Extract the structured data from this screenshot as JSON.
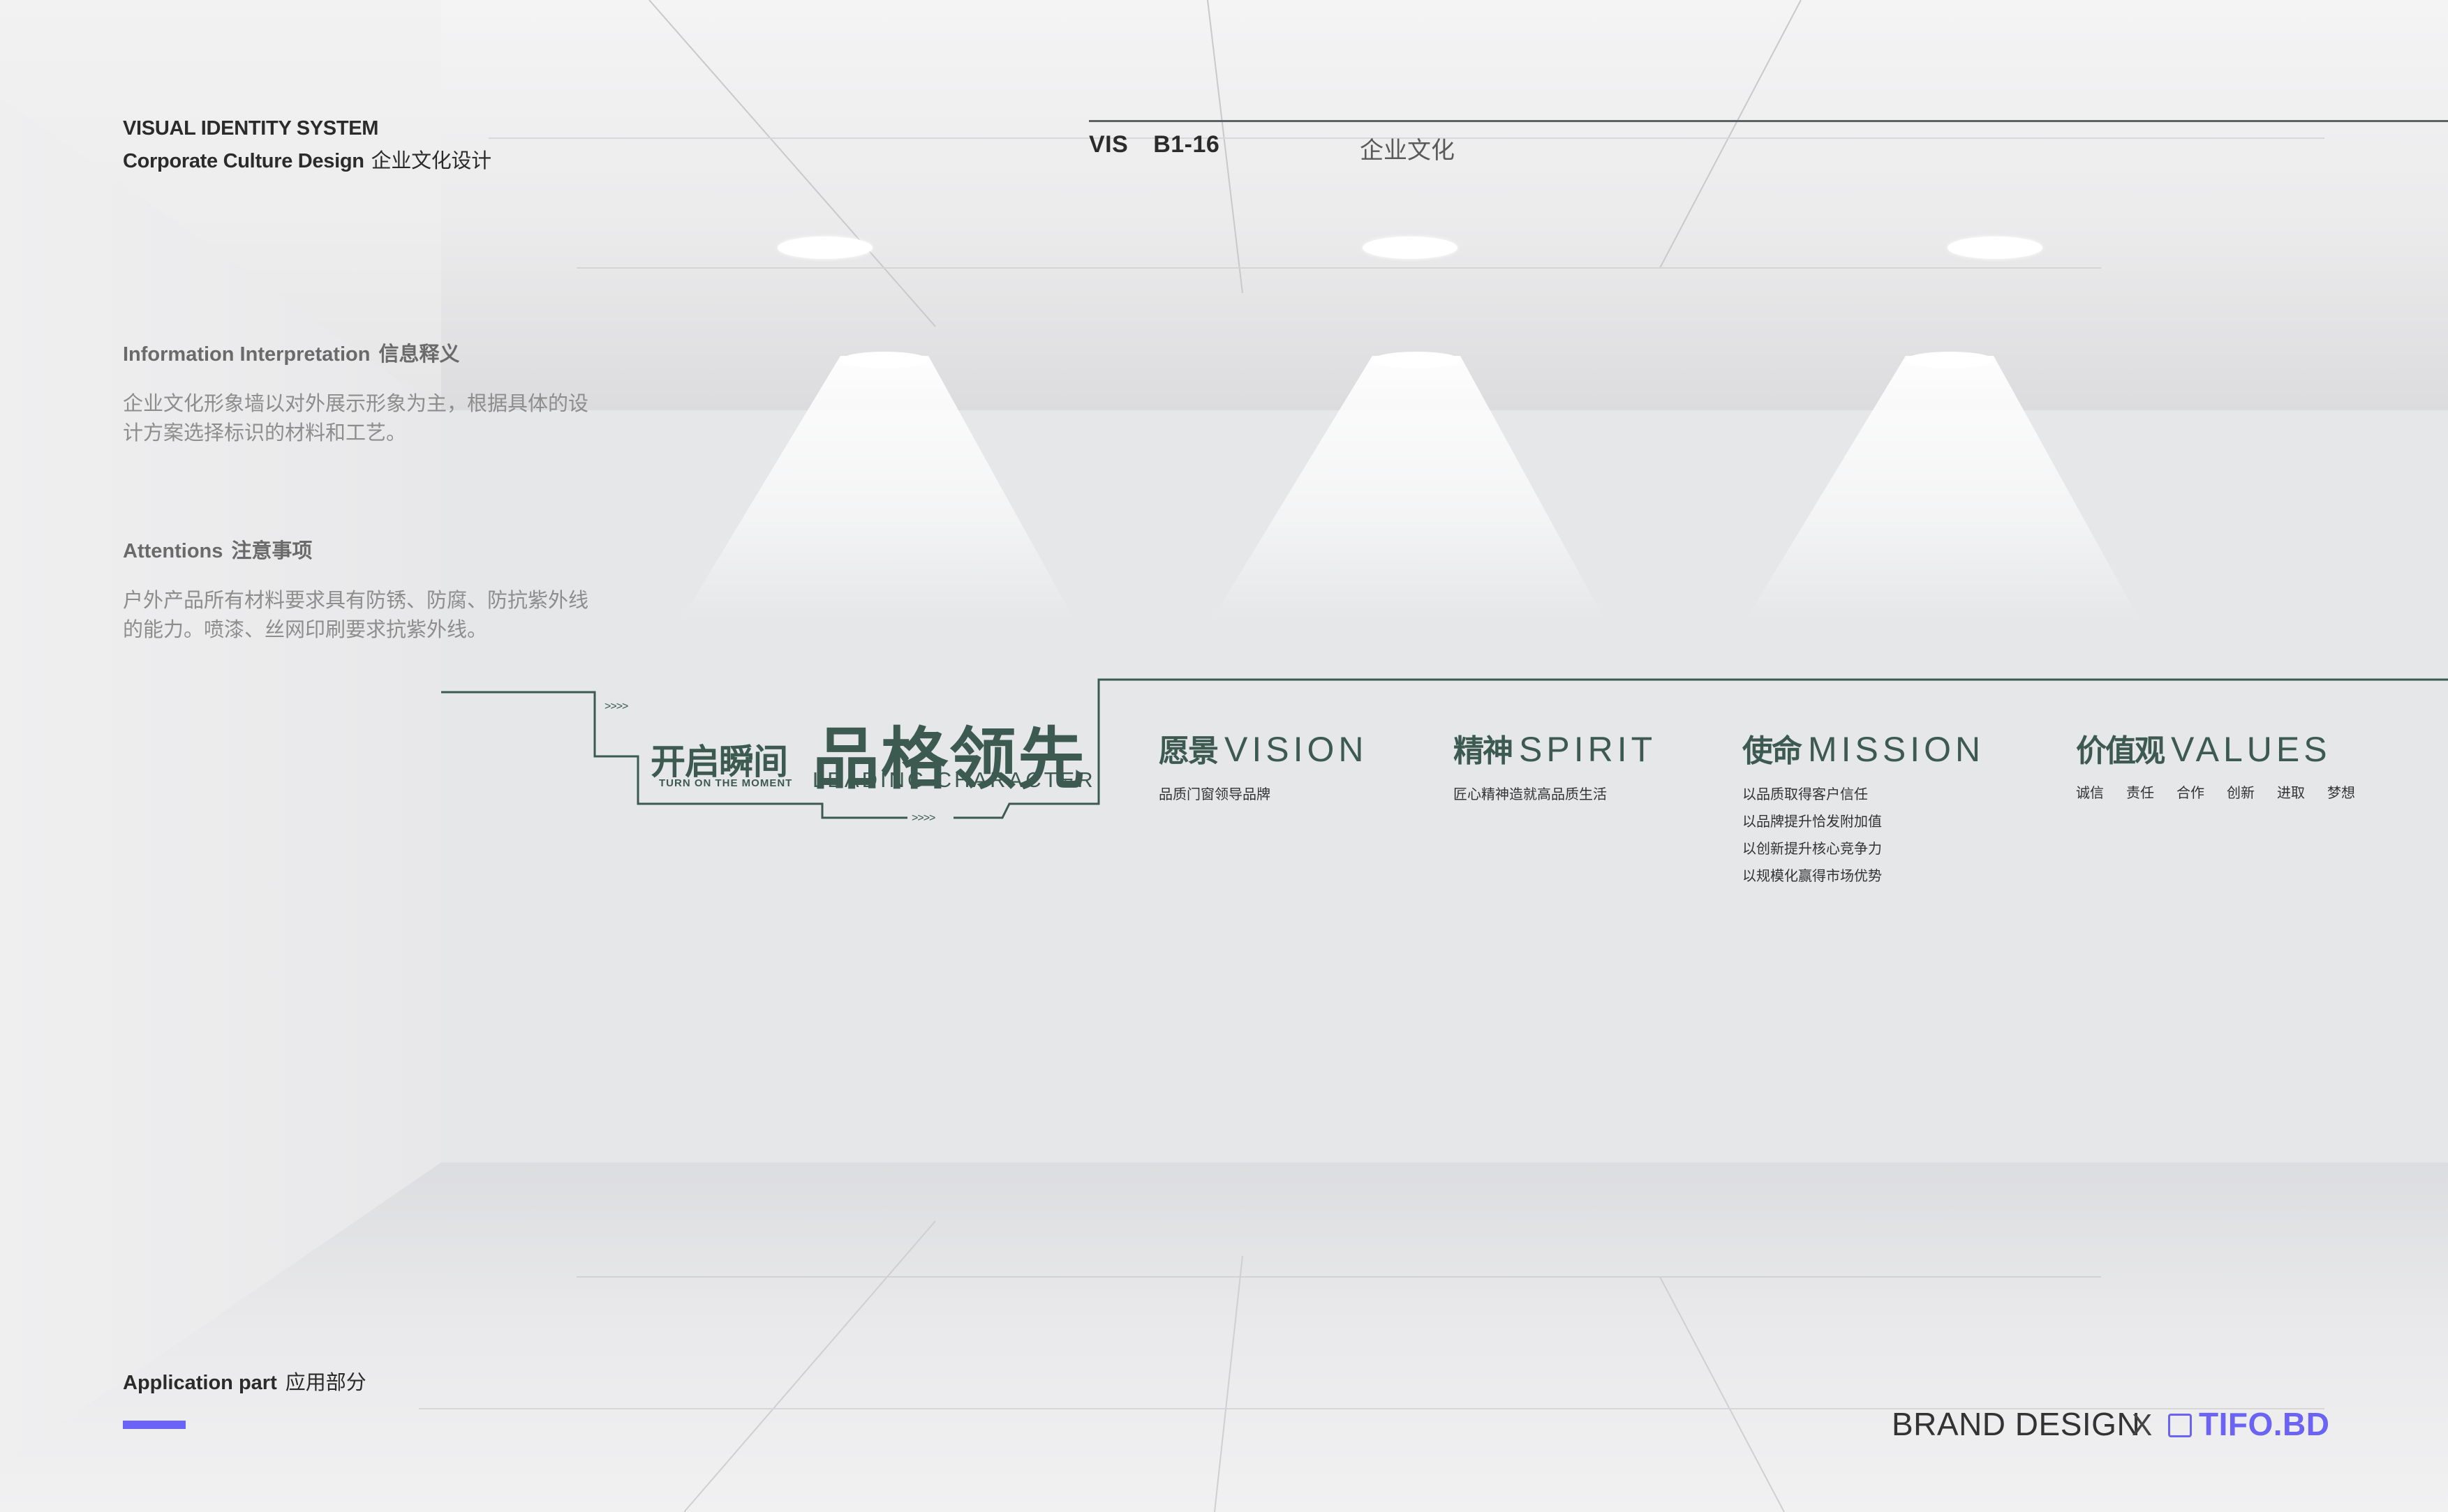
{
  "header": {
    "system_title": "VISUAL IDENTITY SYSTEM",
    "subtitle_en": "Corporate Culture Design",
    "subtitle_cn": "企业文化设计",
    "code": "VIS  B1-16",
    "section_cn": "企业文化"
  },
  "info": {
    "interpretation_heading_en": "Information Interpretation",
    "interpretation_heading_cn": "信息释义",
    "interpretation_text": "企业文化形象墙以对外展示形象为主，根据具体的设计方案选择标识的材料和工艺。",
    "attentions_heading_en": "Attentions",
    "attentions_heading_cn": "注意事项",
    "attentions_text": "户外产品所有材料要求具有防锈、防腐、防抗紫外线的能力。喷漆、丝网印刷要求抗紫外线。"
  },
  "culture_wall": {
    "slogan_small_cn": "开启瞬间",
    "slogan_small_en": "TURN ON THE MOMENT",
    "slogan_big_cn": "品格领先",
    "slogan_big_en": "LEADING CHARACTER",
    "arrow_glyph": ">>>>",
    "arrow_glyph_short": ">>>",
    "vision": {
      "cn": "愿景",
      "en": "VISION",
      "lines": [
        "品质门窗领导品牌"
      ]
    },
    "spirit": {
      "cn": "精神",
      "en": "SPIRIT",
      "lines": [
        "匠心精神造就高品质生活"
      ]
    },
    "mission": {
      "cn": "使命",
      "en": "MISSION",
      "lines": [
        "以品质取得客户信任",
        "以品牌提升恰发附加值",
        "以创新提升核心竞争力",
        "以规模化赢得市场优势"
      ]
    },
    "values": {
      "cn": "价值观",
      "en": "VALUES",
      "items": [
        "诚信",
        "责任",
        "合作",
        "创新",
        "进取",
        "梦想"
      ]
    },
    "colors": {
      "wall_green": "#3d5a51"
    }
  },
  "footer": {
    "application_en": "Application part",
    "application_cn": "应用部分",
    "brand_text": "BRAND DESIGN",
    "separator": "X",
    "logo_text": "TIFO.BD",
    "colors": {
      "accent": "#6b63f5"
    }
  },
  "icons": {
    "logo_mark": "tifo-logo-icon",
    "lamps": "ceiling-lamp-icon"
  }
}
